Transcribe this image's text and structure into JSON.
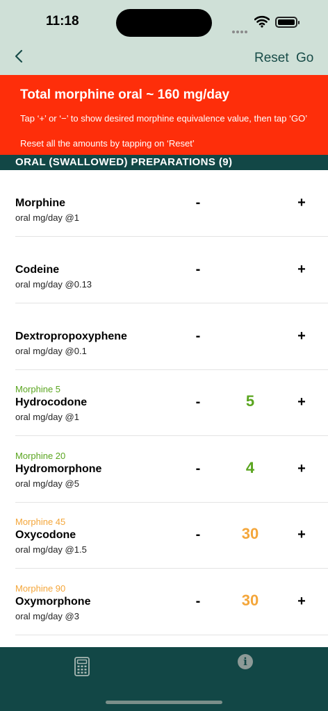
{
  "status_bar": {
    "time": "11:18"
  },
  "nav": {
    "back_label": "‹",
    "reset_label": "Reset",
    "go_label": "Go"
  },
  "banner": {
    "title": "Total morphine oral ~ 160 mg/day",
    "instruction": "Tap ‘+’ or ‘−’ to show desired morphine equivalence value, then tap ‘GO’",
    "reset_hint": "Reset all the amounts by tapping on ‘Reset’"
  },
  "section": {
    "title": "ORAL (SWALLOWED) PREPARATIONS (9)"
  },
  "controls": {
    "minus": "-",
    "plus": "+"
  },
  "colors": {
    "green": "#5aa51f",
    "orange": "#f4a63a",
    "banner": "#fe2e0a",
    "dark_teal": "#124746"
  },
  "drugs": [
    {
      "name": "Morphine",
      "sub": "oral mg/day @1",
      "equiv": "",
      "qty": ""
    },
    {
      "name": "Codeine",
      "sub": "oral mg/day @0.13",
      "equiv": "",
      "qty": ""
    },
    {
      "name": "Dextropropoxyphene",
      "sub": "oral mg/day @0.1",
      "equiv": "",
      "qty": ""
    },
    {
      "name": "Hydrocodone",
      "sub": "oral mg/day @1",
      "equiv": "Morphine 5",
      "qty": "5"
    },
    {
      "name": "Hydromorphone",
      "sub": "oral mg/day @5",
      "equiv": "Morphine 20",
      "qty": "4"
    },
    {
      "name": "Oxycodone",
      "sub": "oral mg/day @1.5",
      "equiv": "Morphine 45",
      "qty": "30"
    },
    {
      "name": "Oxymorphone",
      "sub": "oral mg/day @3",
      "equiv": "Morphine 90",
      "qty": "30"
    }
  ],
  "tabbar": {
    "tabs": [
      {
        "icon": "calculator-icon"
      },
      {
        "icon": "info-icon",
        "glyph": "i"
      }
    ]
  }
}
